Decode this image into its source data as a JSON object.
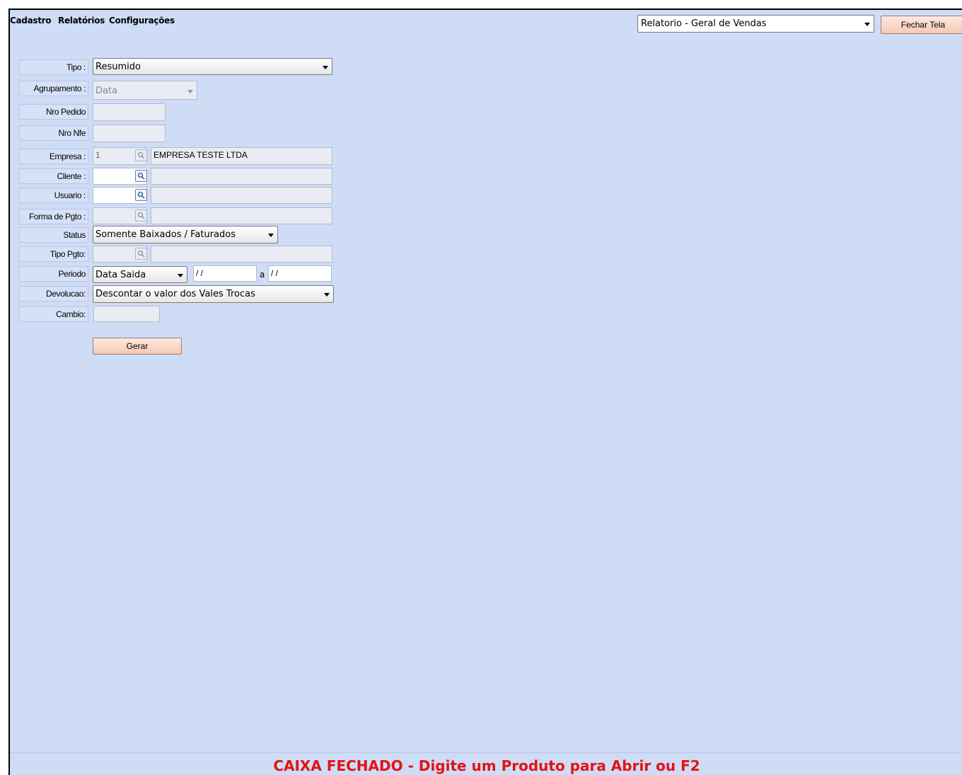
{
  "menu": {
    "items": [
      "Cadastro",
      "Relatórios",
      "Configurações"
    ]
  },
  "report_select": {
    "value": "Relatorio - Geral de Vendas"
  },
  "close_button": {
    "label": "Fechar Tela"
  },
  "form": {
    "tipo": {
      "label": "Tipo :",
      "value": "Resumido"
    },
    "agrupamento": {
      "label": "Agrupamento :",
      "value": "Data"
    },
    "nro_pedido": {
      "label": "Nro Pedido",
      "value": ""
    },
    "nro_nfe": {
      "label": "Nro Nfe",
      "value": ""
    },
    "empresa": {
      "label": "Empresa :",
      "code": "1",
      "name": "EMPRESA TESTE LTDA"
    },
    "cliente": {
      "label": "Cliente :",
      "code": "",
      "name": ""
    },
    "usuario": {
      "label": "Usuario :",
      "code": "",
      "name": ""
    },
    "forma_pgto": {
      "label": "Forma de Pgto :",
      "code": "",
      "name": ""
    },
    "status": {
      "label": "Status",
      "value": "Somente Baixados / Faturados"
    },
    "tipo_pgto": {
      "label": "Tipo Pgto:",
      "code": "",
      "name": ""
    },
    "periodo": {
      "label": "Periodo",
      "type": "Data Saida",
      "from": " / /",
      "separator": "a",
      "to": " / /"
    },
    "devolucao": {
      "label": "Devolucao:",
      "value": "Descontar o valor dos Vales Trocas"
    },
    "cambio": {
      "label": "Cambio:",
      "value": ""
    }
  },
  "generate_button": {
    "label": "Gerar"
  },
  "status_bar": {
    "message": "CAIXA FECHADO - Digite um Produto para Abrir ou F2"
  },
  "colors": {
    "background": "#cfdcf6",
    "status_text": "#e41212",
    "button": "#f6c9b4"
  }
}
